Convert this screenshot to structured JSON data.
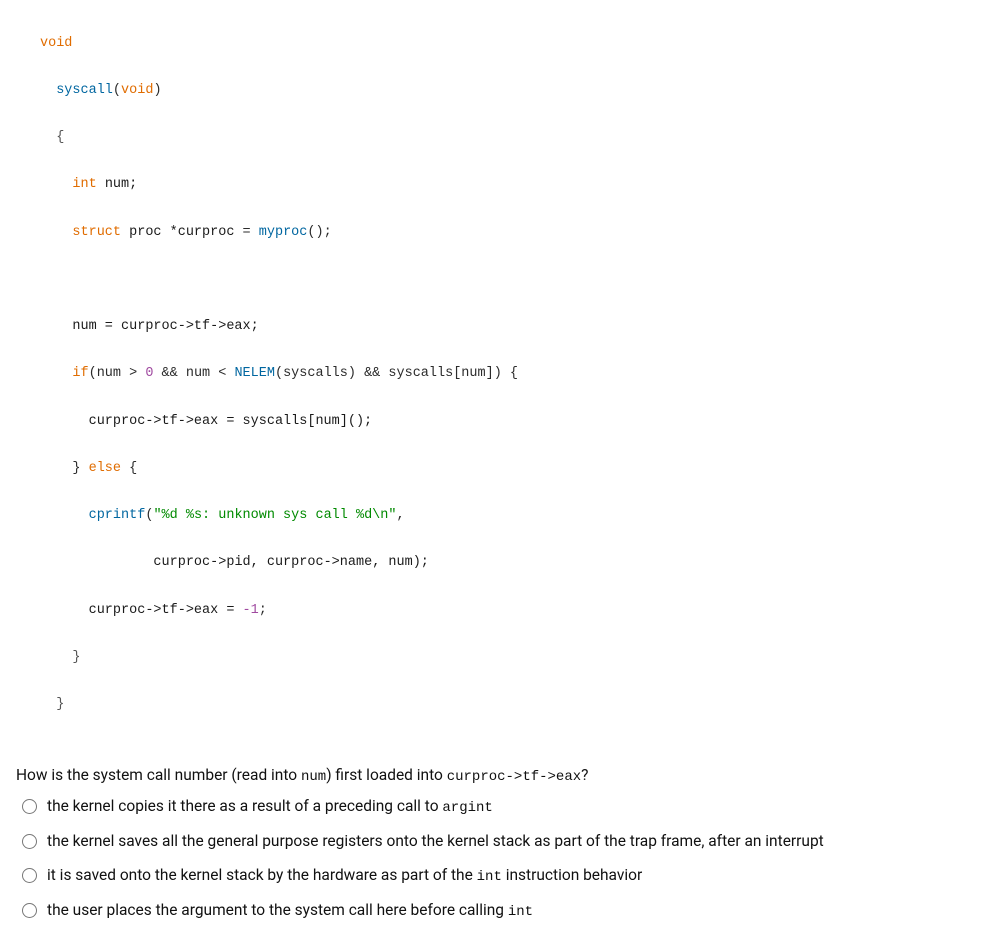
{
  "code": {
    "l01a": "void",
    "l02a": "syscall",
    "l02b": "(",
    "l02c": "void",
    "l02d": ")",
    "l03a": "{",
    "l04a": "int",
    "l04b": " num;",
    "l05a": "struct",
    "l05b": " proc *",
    "l05c": "curproc",
    "l05d": " = ",
    "l05e": "myproc",
    "l05f": "();",
    "l07a": "num = curproc->tf->eax;",
    "l08a": "if",
    "l08b": "(num > ",
    "l08c": "0",
    "l08d": " && num < ",
    "l08e": "NELEM",
    "l08f": "(syscalls) && syscalls[num]) {",
    "l09a": "curproc->tf->eax = syscalls[num]();",
    "l10a": "} ",
    "l10b": "else",
    "l10c": " {",
    "l11a": "cprintf",
    "l11b": "(",
    "l11c": "\"%d %s: unknown sys call %d\\n\"",
    "l11d": ",",
    "l12a": "curproc->",
    "l12b": "pid",
    "l12c": ", curproc->",
    "l12d": "name",
    "l12e": ", num);",
    "l13a": "curproc->tf->eax = ",
    "l13b": "-1",
    "l13c": ";",
    "l14a": "}",
    "l15a": "}"
  },
  "question": {
    "p1": "How is the system call number (read into ",
    "m1": "num",
    "p2": ") first loaded into ",
    "m2": "curproc->tf->eax",
    "p3": "?"
  },
  "options": {
    "a": {
      "p1": "the kernel copies it there as a result of a preceding call to ",
      "m1": "argint"
    },
    "b": {
      "p1": "the kernel saves all the general purpose registers onto the kernel stack as part of the trap frame, after an interrupt"
    },
    "c": {
      "p1": "it is saved onto the kernel stack by the hardware as part of the ",
      "m1": "int",
      "p2": " instruction behavior"
    },
    "d": {
      "p1": "the user places the argument to the system call here before calling ",
      "m1": "int"
    }
  }
}
